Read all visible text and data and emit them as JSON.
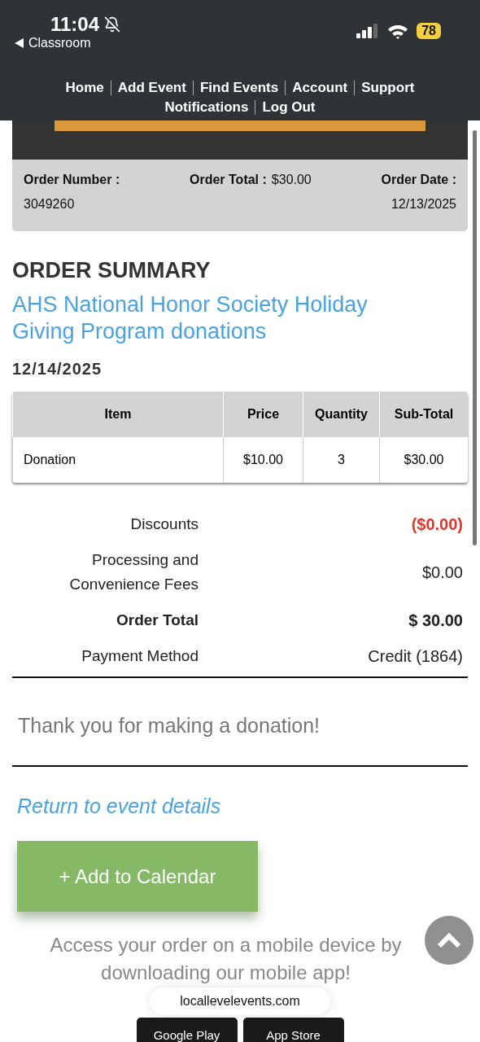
{
  "status_bar": {
    "time": "11:04",
    "back_label": "Classroom",
    "battery": "78",
    "muted": true
  },
  "nav": [
    "Home",
    "Add Event",
    "Find Events",
    "Account",
    "Support",
    "Notifications",
    "Log Out"
  ],
  "order_info": {
    "number_label": "Order Number :",
    "number": "3049260",
    "total_label": "Order Total :",
    "total": "$30.00",
    "date_label": "Order Date :",
    "date": "12/13/2025"
  },
  "heading": "ORDER SUMMARY",
  "event_title": "AHS National Honor Society Holiday Giving Program donations",
  "event_date": "12/14/2025",
  "table": {
    "columns": [
      "Item",
      "Price",
      "Quantity",
      "Sub-Total"
    ],
    "rows": [
      [
        "Donation",
        "$10.00",
        "3",
        "$30.00"
      ]
    ]
  },
  "summary": [
    {
      "kind": "discount",
      "label": "Discounts",
      "value": "($0.00)"
    },
    {
      "kind": "normal",
      "label": "Processing and Convenience Fees",
      "value": "$0.00"
    },
    {
      "kind": "total",
      "label": "Order Total",
      "value": "$ 30.00"
    },
    {
      "kind": "normal",
      "label": "Payment Method",
      "value": "Credit (1864)"
    }
  ],
  "thank_you": "Thank you for making a donation!",
  "return_link": "Return to event details",
  "calendar_button": "+ Add to Calendar",
  "app_promo": "Access your order on a mobile device by downloading our mobile app!",
  "store_badges": [
    "Google Play",
    "App Store"
  ],
  "url_pill": "locallevelevents.com"
}
